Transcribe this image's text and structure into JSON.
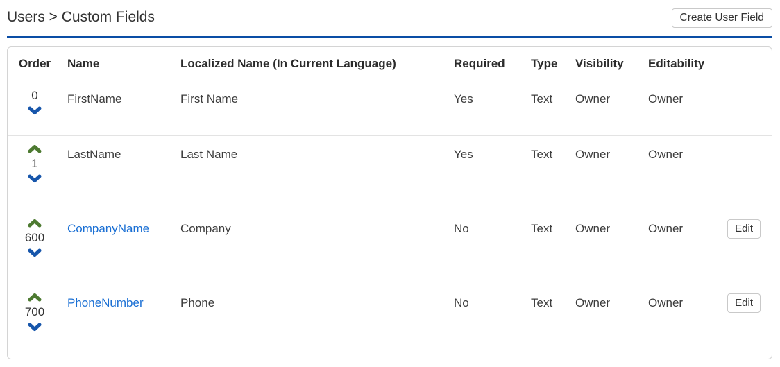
{
  "page": {
    "title": "Users > Custom Fields",
    "create_user_field_button": "Create User Field"
  },
  "colors": {
    "accent-blue": "#0a4da5",
    "link-blue": "#1a6fd4",
    "chevron-down-blue": "#1756ab",
    "chevron-up-green": "#4d7a31"
  },
  "icons": {
    "move_up": "chevron-up",
    "move_down": "chevron-down"
  },
  "table": {
    "headers": {
      "order": "Order",
      "name": "Name",
      "localized_name": "Localized Name (In Current Language)",
      "required": "Required",
      "type": "Type",
      "visibility": "Visibility",
      "editability": "Editability"
    },
    "edit_button_label": "Edit",
    "rows": [
      {
        "order": "0",
        "name": "FirstName",
        "localized_name": "First Name",
        "required": "Yes",
        "type": "Text",
        "visibility": "Owner",
        "editability": "Owner"
      },
      {
        "order": "1",
        "name": "LastName",
        "localized_name": "Last Name",
        "required": "Yes",
        "type": "Text",
        "visibility": "Owner",
        "editability": "Owner"
      },
      {
        "order": "600",
        "name": "CompanyName",
        "localized_name": "Company",
        "required": "No",
        "type": "Text",
        "visibility": "Owner",
        "editability": "Owner"
      },
      {
        "order": "700",
        "name": "PhoneNumber",
        "localized_name": "Phone",
        "required": "No",
        "type": "Text",
        "visibility": "Owner",
        "editability": "Owner"
      }
    ]
  }
}
